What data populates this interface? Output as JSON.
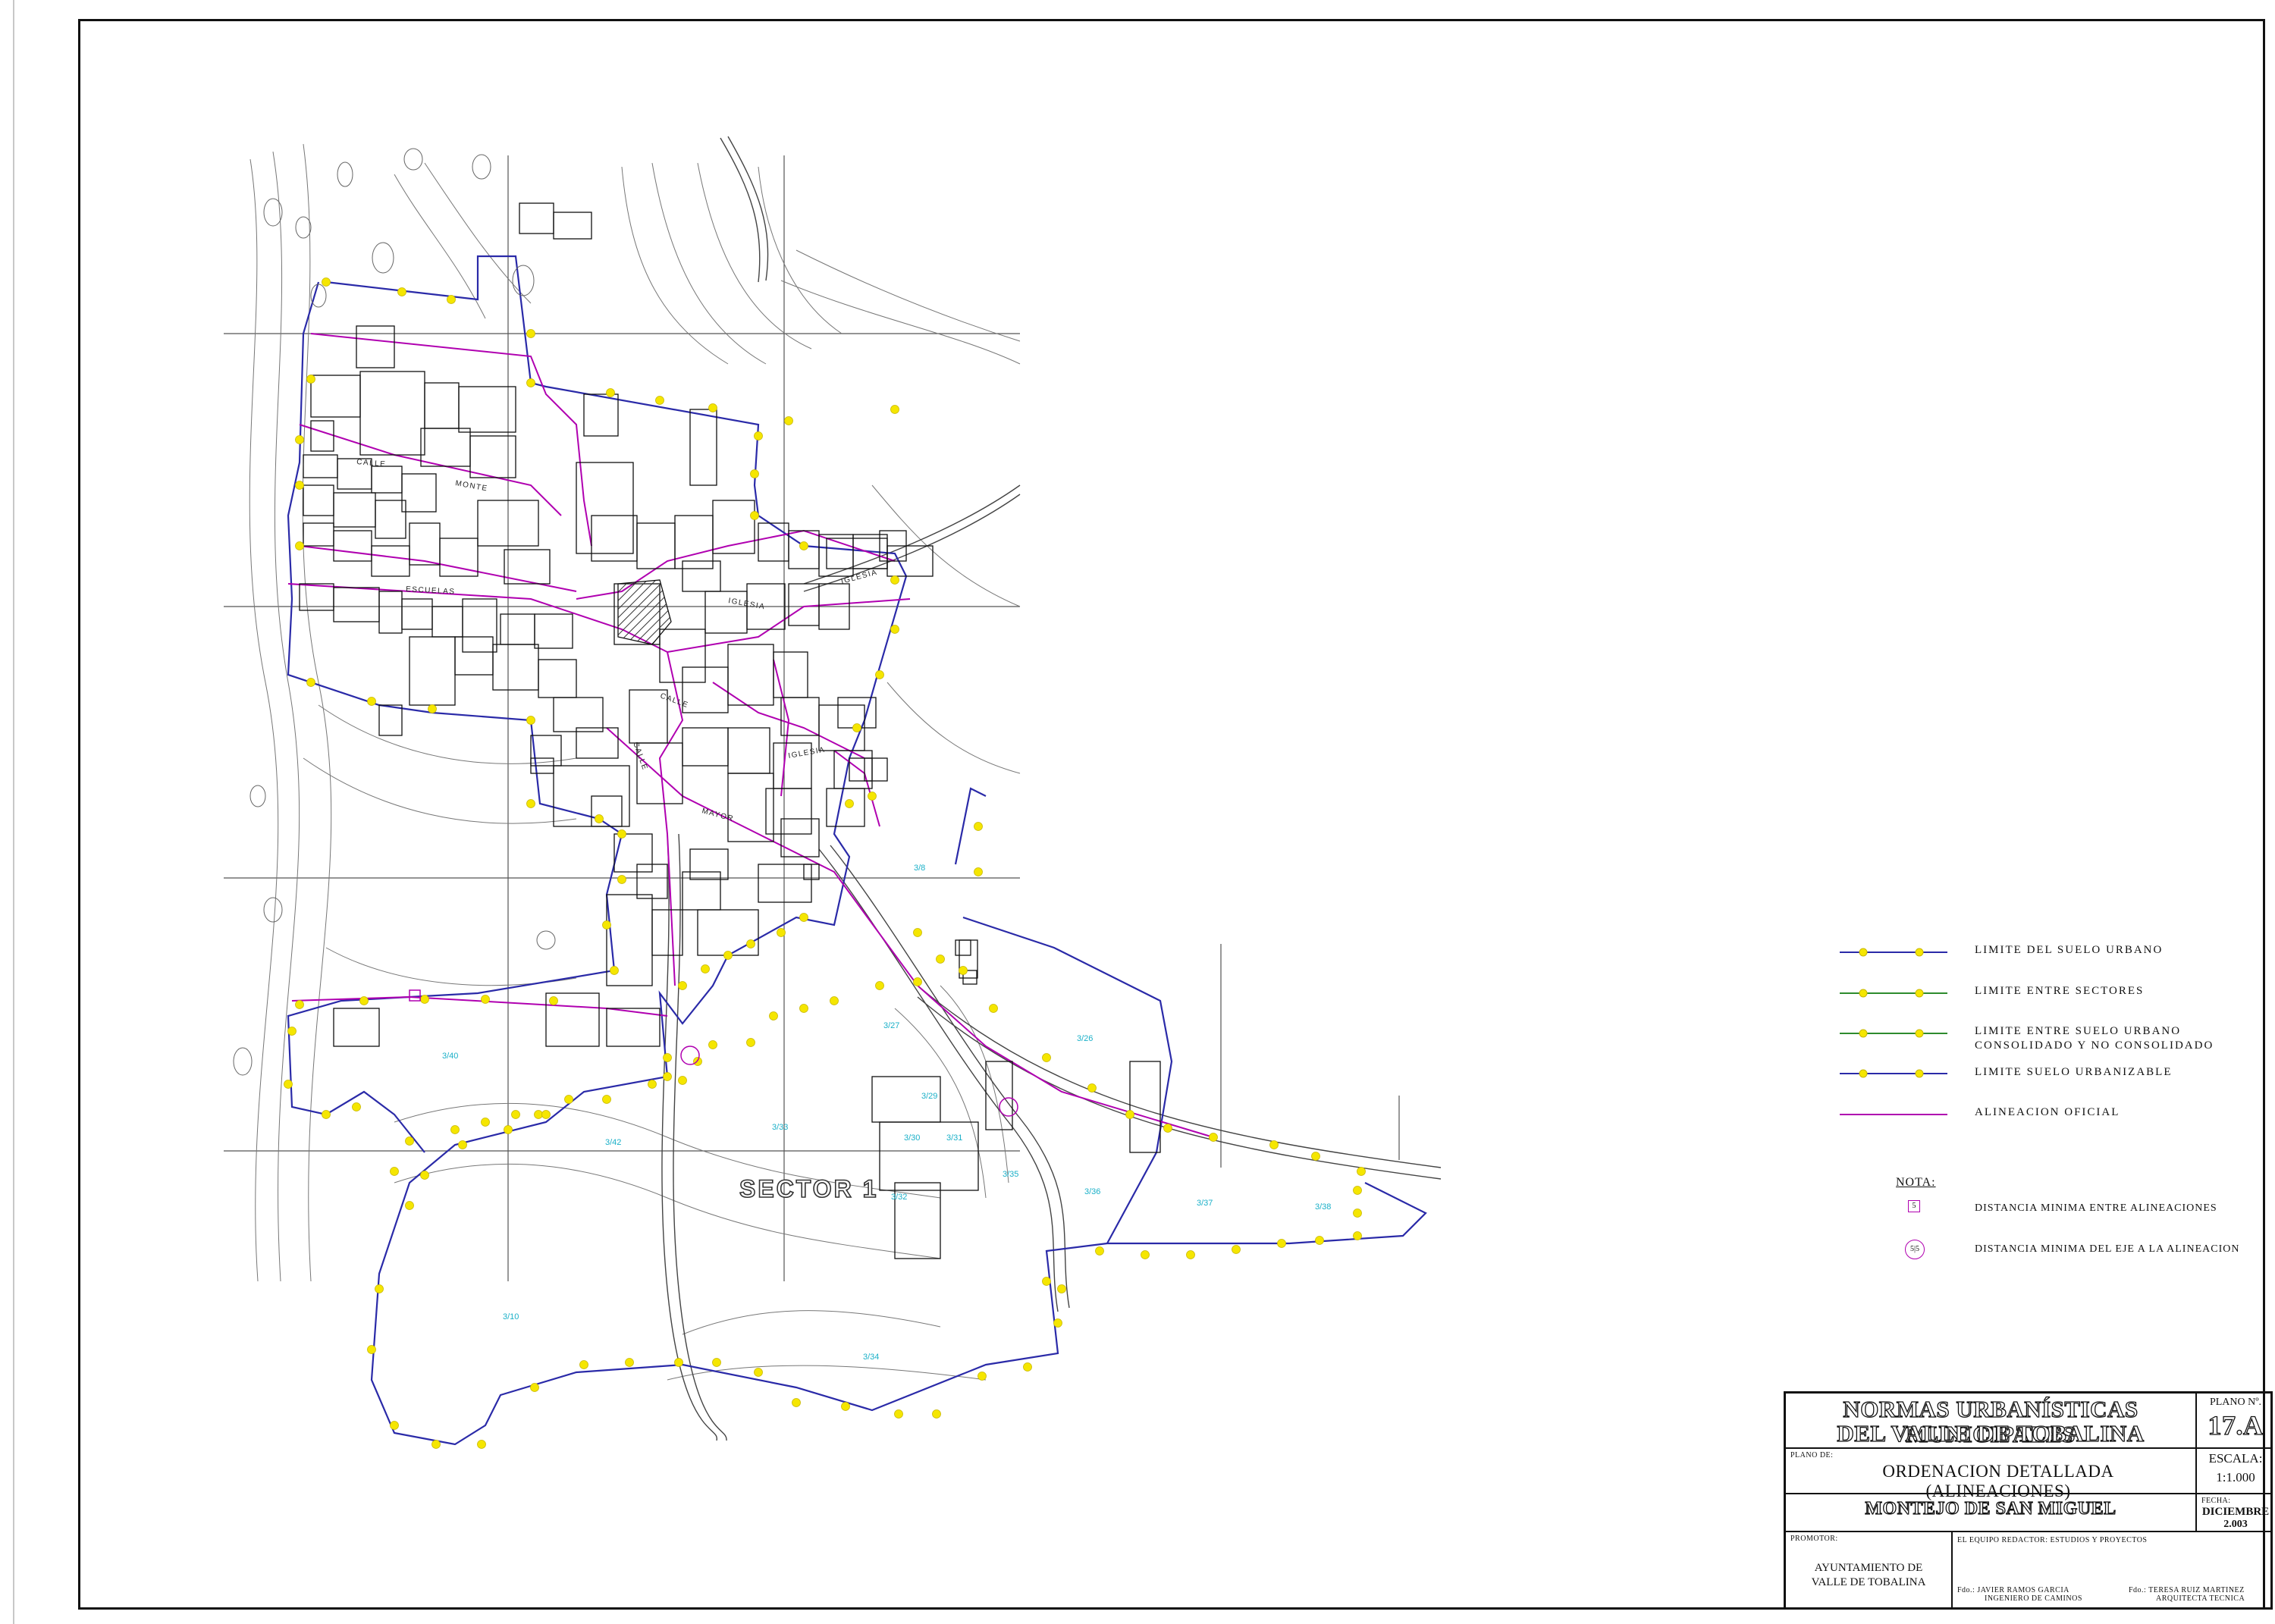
{
  "map": {
    "sector_label": "SECTOR 1",
    "street_labels": [
      "CALLE",
      "MONTE",
      "ESCUELAS",
      "IGLESIA",
      "CALLE",
      "IGLESIA",
      "MAYOR",
      "CALLE",
      "IGLESIA"
    ],
    "poly_labels": [
      "3/8",
      "3/27",
      "3/26",
      "3/29",
      "3/30",
      "3/31",
      "3/32",
      "3/33",
      "3/34",
      "3/35",
      "3/36",
      "3/37",
      "3/38",
      "3/10",
      "3/40",
      "3/42"
    ],
    "colors": {
      "urban_limit": "#2a2aa8",
      "sector_limit": "#2e8b2e",
      "alignment": "#b000b0",
      "marker": "#f5e600",
      "cyan_label": "#1ab0c8"
    }
  },
  "legend": {
    "items": [
      {
        "label": "LIMITE DEL SUELO URBANO",
        "line_color": "#2a2aa8",
        "dot_color": "#f5e600"
      },
      {
        "label": "LIMITE ENTRE SECTORES",
        "line_color": "#2e8b2e",
        "dot_color": "#f5e600"
      },
      {
        "label": "LIMITE ENTRE SUELO URBANO",
        "label2": "CONSOLIDADO Y NO CONSOLIDADO",
        "line_color": "#2e8b2e",
        "dot_color": "#f5e600"
      },
      {
        "label": "LIMITE SUELO URBANIZABLE",
        "line_color": "#2a2aa8",
        "dot_color": "#f5e600"
      },
      {
        "label": "ALINEACION OFICIAL",
        "line_color": "#b000b0"
      }
    ],
    "nota": "NOTA:",
    "notes": [
      {
        "symbol": "5",
        "label": "DISTANCIA MINIMA ENTRE ALINEACIONES"
      },
      {
        "symbol": "5|5",
        "label": "DISTANCIA MINIMA DEL EJE A LA ALINEACION"
      }
    ]
  },
  "title_block": {
    "title_line1": "NORMAS URBANÍSTICAS MUNICIPALES",
    "title_line2": "DEL VALLE DE TOBALINA",
    "plano_label": "PLANO Nº.",
    "plano_number": "17.A",
    "plano_de_label": "PLANO DE:",
    "plano_de_value": "ORDENACION DETALLADA (ALINEACIONES)",
    "escala_label": "ESCALA:",
    "escala_value": "1:1.000",
    "place": "MONTEJO DE SAN MIGUEL",
    "fecha_label": "FECHA:",
    "fecha_month": "DICIEMBRE",
    "fecha_year": "2.003",
    "promotor_label": "PROMOTOR:",
    "promotor_line1": "AYUNTAMIENTO DE",
    "promotor_line2": "VALLE DE TOBALINA",
    "equipo": "EL EQUIPO REDACTOR: ESTUDIOS Y PROYECTOS",
    "firma1_line1": "Fdo.: JAVIER RAMOS GARCIA",
    "firma1_line2": "INGENIERO DE CAMINOS",
    "firma2_line1": "Fdo.: TERESA RUIZ MARTINEZ",
    "firma2_line2": "ARQUITECTA TECNICA"
  }
}
